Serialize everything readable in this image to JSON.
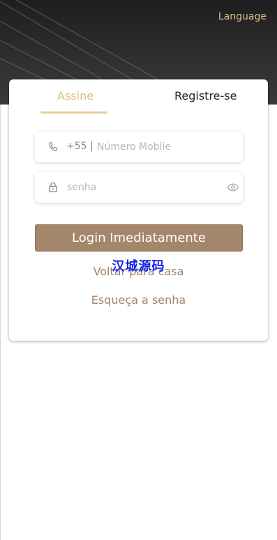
{
  "header": {
    "language_label": "Language"
  },
  "tabs": [
    {
      "label": "Assine",
      "active": true
    },
    {
      "label": "Registre-se",
      "active": false
    }
  ],
  "form": {
    "country_code": "+55 |",
    "phone_placeholder": "Número Moblie",
    "password_placeholder": "senha",
    "login_label": "Login Imediatamente"
  },
  "links": {
    "home": "Voltar para casa",
    "forgot": "Esqueça a senha"
  },
  "watermark": "汉城源码",
  "colors": {
    "accent_gold": "#d9bd84",
    "button_brown": "#a4866b",
    "link_brown": "#a0826a",
    "header_dark": "#2f2f2f"
  },
  "icons": {
    "phone": "phone-icon",
    "lock": "lock-icon",
    "eye": "eye-icon"
  }
}
